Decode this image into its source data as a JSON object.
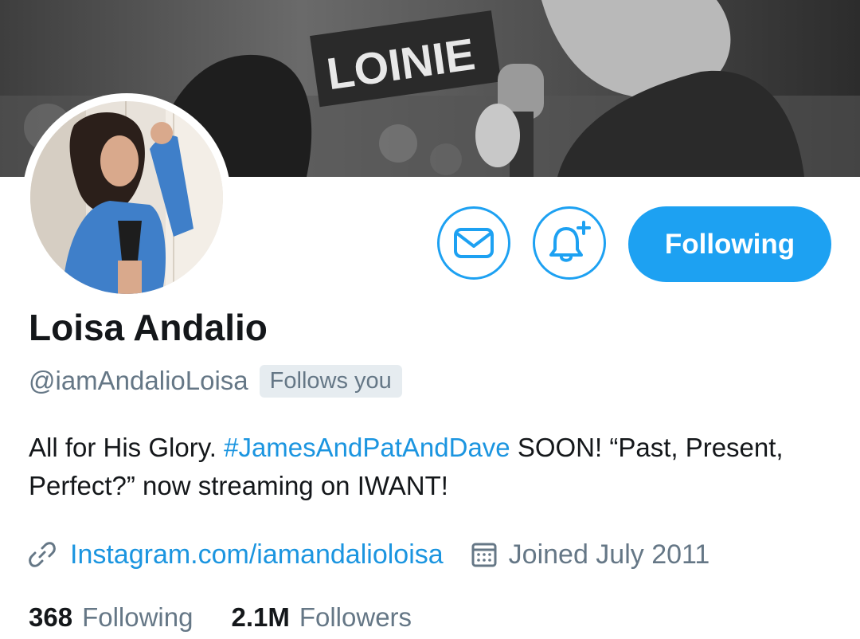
{
  "banner": {
    "sign_text": "LOINIE"
  },
  "profile": {
    "display_name": "Loisa Andalio",
    "handle": "@iamAndalioLoisa",
    "follows_you_badge": "Follows you",
    "bio": {
      "part1": "All for His Glory. ",
      "hashtag": "#JamesAndPatAndDave",
      "part2": " SOON! “Past, Present, Perfect?” now streaming on IWANT!"
    },
    "link": "Instagram.com/iamandalioloisa",
    "joined": "Joined July 2011"
  },
  "actions": {
    "message_icon": "envelope-icon",
    "notify_icon": "bell-plus-icon",
    "follow_label": "Following"
  },
  "stats": {
    "following_count": "368",
    "following_label": "Following",
    "followers_count": "2.1M",
    "followers_label": "Followers"
  },
  "colors": {
    "accent": "#1da1f2",
    "link": "#1b95e0",
    "muted": "#657786",
    "text": "#14171a"
  }
}
